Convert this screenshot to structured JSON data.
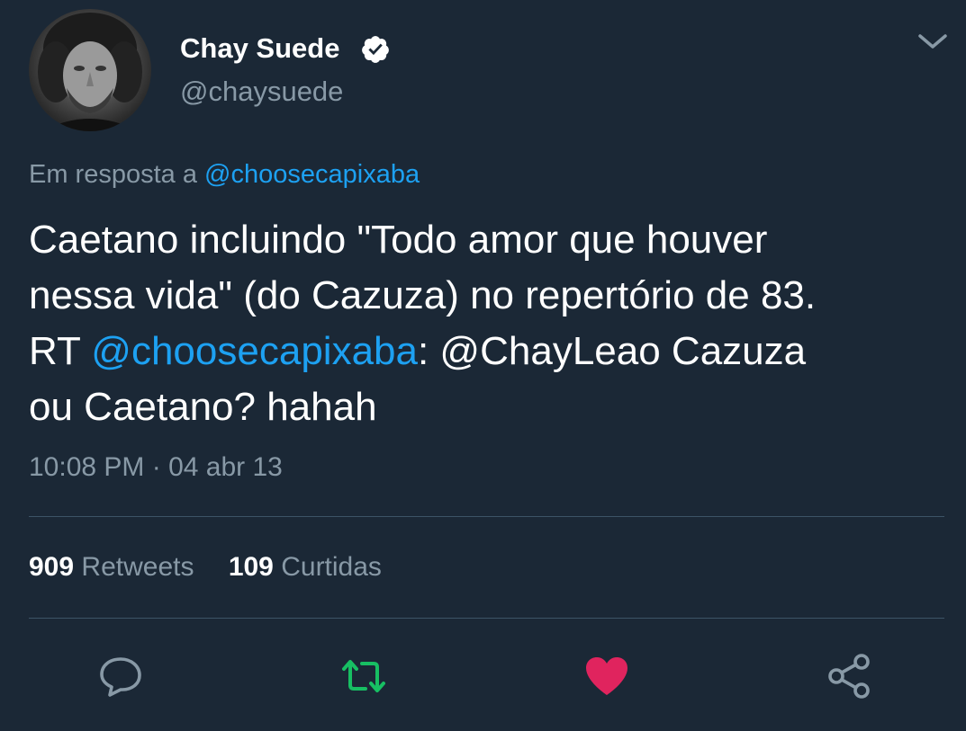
{
  "author": {
    "display_name": "Chay Suede",
    "handle": "@chaysuede",
    "verified": true
  },
  "reply_context": {
    "prefix": "Em resposta a",
    "mention": "@choosecapixaba"
  },
  "tweet": {
    "line1": "Caetano incluindo \"Todo amor que houver",
    "line2": "nessa vida\" (do Cazuza) no repertório de 83.",
    "line3_prefix": "RT ",
    "line3_mention": "@choosecapixaba",
    "line3_suffix": ": @ChayLeao Cazuza",
    "line4": "ou Caetano? hahah"
  },
  "timestamp": "10:08 PM · 04 abr 13",
  "stats": {
    "retweets_count": "909",
    "retweets_label": "Retweets",
    "likes_count": "109",
    "likes_label": "Curtidas"
  },
  "actions": [
    {
      "name": "reply-icon",
      "color": "#8899a6"
    },
    {
      "name": "retweet-icon",
      "color": "#17bf63",
      "active": true
    },
    {
      "name": "heart-icon",
      "color": "#e0245e",
      "active": true
    },
    {
      "name": "share-icon",
      "color": "#8899a6"
    }
  ],
  "colors": {
    "background": "#1b2836",
    "link": "#1da1f2",
    "secondary_text": "#8899a6",
    "divider": "#3d5466"
  }
}
